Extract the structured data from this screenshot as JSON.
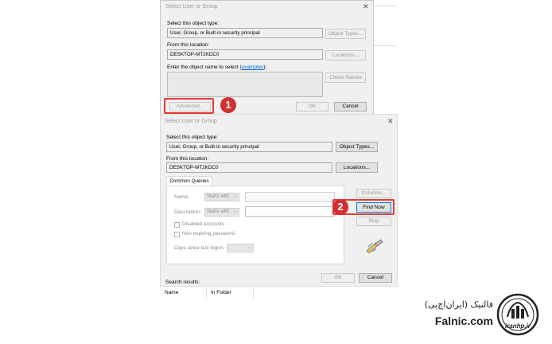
{
  "dialog1": {
    "title": "Select User or Group",
    "object_type_label": "Select this object type:",
    "object_type_value": "User, Group, or Built-in security principal",
    "object_types_btn": "Object Types...",
    "location_label": "From this location:",
    "location_value": "DESKTOP-MT2KDC0",
    "locations_btn": "Locations...",
    "enter_label_prefix": "Enter the object name to select (",
    "examples_link": "examples",
    "enter_label_suffix": "):",
    "check_names_btn": "Check Names",
    "advanced_btn": "Advanced...",
    "ok_btn": "OK",
    "cancel_btn": "Cancel",
    "step_badge": "1"
  },
  "dialog2": {
    "title": "Select User or Group",
    "object_type_label": "Select this object type:",
    "object_type_value": "User, Group, or Built-in security principal",
    "object_types_btn": "Object Types...",
    "location_label": "From this location:",
    "location_value": "DESKTOP-MT2KDC0",
    "locations_btn": "Locations...",
    "tab_label": "Common Queries",
    "name_label": "Name:",
    "name_filter": "Starts with",
    "description_label": "Description:",
    "description_filter": "Starts with",
    "disabled_accounts": "Disabled accounts",
    "non_expiring": "Non expiring password",
    "days_label": "Days since last logon:",
    "columns_btn": "Columns...",
    "find_now_btn": "Find Now",
    "stop_btn": "Stop",
    "ok_btn": "OK",
    "cancel_btn": "Cancel",
    "search_results_label": "Search results:",
    "result_columns": [
      "Name",
      "In Folder"
    ],
    "step_badge": "2"
  },
  "logo": {
    "brand_fa": "فالنیک (ایران‌اچ‌پی)",
    "brand_en": "Falnic.com",
    "seal_text": "iranhp.ir"
  },
  "colors": {
    "highlight": "#e53935",
    "badge": "#d32f2f",
    "link": "#0066cc"
  }
}
